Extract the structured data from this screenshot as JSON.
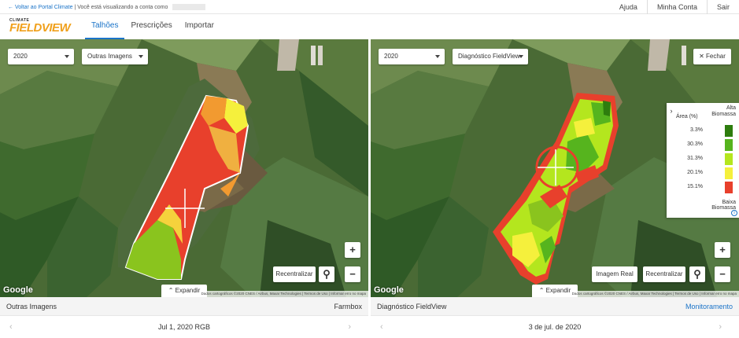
{
  "topbar": {
    "back_link": "← Voltar ao Portal Climate",
    "notice": "| Você está visualizando a conta como",
    "nav": [
      "Ajuda",
      "Minha Conta",
      "Sair"
    ]
  },
  "header": {
    "logo_small": "CLIMATE",
    "logo_big": "FIELDVIEW",
    "tabs": [
      {
        "label": "Talhões",
        "active": true
      },
      {
        "label": "Prescrições",
        "active": false
      },
      {
        "label": "Importar",
        "active": false
      }
    ]
  },
  "left": {
    "year": "2020",
    "layer": "Outras Imagens",
    "recenter": "Recentralizar",
    "plus": "+",
    "minus": "−",
    "expand": "Expandir",
    "google": "Google",
    "attribution": "Dados cartográficos ©2020 CNES / Airbus, Maxar Technologies  |  Termos de Uso  |  Informar erro no mapa",
    "info_title": "Outras Imagens",
    "info_right": "Farmbox",
    "date": "Jul 1, 2020 RGB"
  },
  "right": {
    "year": "2020",
    "layer": "Diagnóstico FieldView",
    "close": "Fechar",
    "real_image": "Imagem Real",
    "recenter": "Recentralizar",
    "plus": "+",
    "minus": "−",
    "expand": "Expandir",
    "google": "Google",
    "attribution": "Dados cartográficos ©2020 CNES / Airbus, Maxar Technologies  |  Termos de Uso  |  Informar erro no mapa",
    "info_title": "Diagnóstico FieldView",
    "info_right": "Monitoramento",
    "date": "3 de jul. de 2020"
  },
  "legend": {
    "toggle": "›",
    "area_header": "Área (%)",
    "high_line1": "Alta",
    "high_line2": "Biomassa",
    "rows": [
      {
        "pct": "3.3%",
        "color": "#2e7d0e"
      },
      {
        "pct": "30.3%",
        "color": "#56b41e"
      },
      {
        "pct": "31.3%",
        "color": "#b4e61e"
      },
      {
        "pct": "20.1%",
        "color": "#f5f03c"
      },
      {
        "pct": "15.1%",
        "color": "#e8402c"
      }
    ],
    "low_line1": "Baixa",
    "low_line2": "Biomassa",
    "info": "i"
  },
  "colors": {
    "accent": "#1a73c8",
    "logo": "#f0a01c"
  }
}
